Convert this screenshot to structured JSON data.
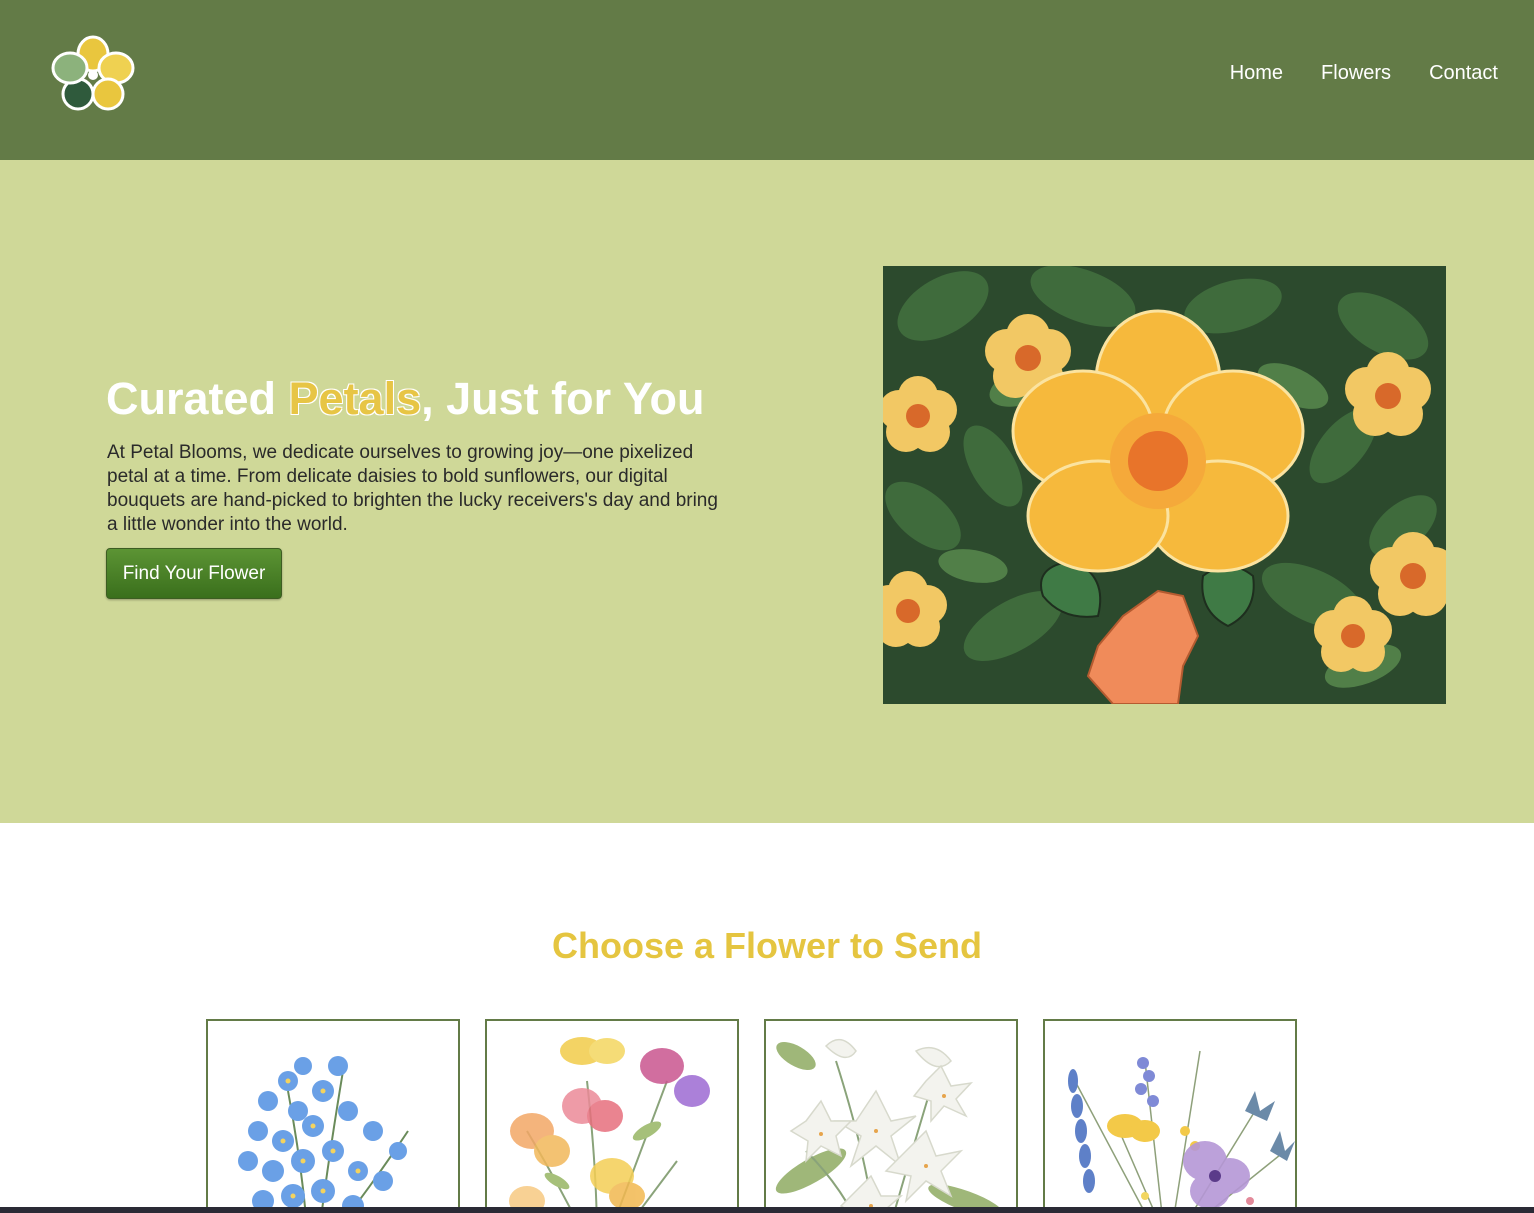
{
  "header": {
    "logo": "flower-logo-icon",
    "nav": [
      "Home",
      "Flowers",
      "Contact"
    ]
  },
  "hero": {
    "title_pre": "Curated ",
    "title_accent": "Petals",
    "title_post": ", Just for You",
    "description": "At Petal Blooms, we dedicate ourselves to growing joy—one pixelized petal at a time. From delicate daisies to bold sunflowers, our digital bouquets are hand-picked to brighten the lucky receivers's day and bring a little wonder into the world.",
    "cta_label": "Find Your Flower",
    "image": "flower-held-in-hand-illustration"
  },
  "flowers": {
    "title": "Choose a Flower to Send",
    "cards": [
      {
        "image": "forget-me-not-icon"
      },
      {
        "image": "watercolor-pansies-icon"
      },
      {
        "image": "white-lilies-icon"
      },
      {
        "image": "wildflower-bouquet-icon"
      }
    ]
  },
  "colors": {
    "header_bg": "#637b47",
    "hero_bg": "#cfd898",
    "accent_yellow": "#e5c540",
    "button_green": "#4a7f27"
  }
}
